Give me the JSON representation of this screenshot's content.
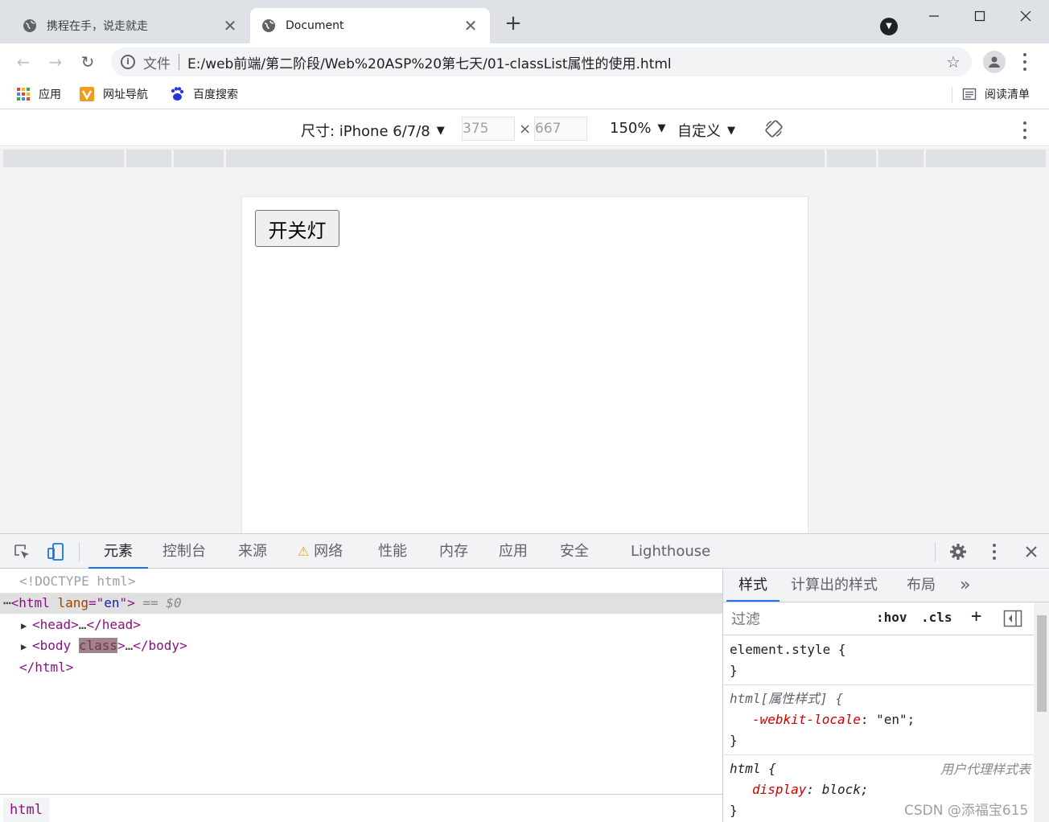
{
  "browser": {
    "tabs": [
      {
        "title": "携程在手，说走就走",
        "active": false,
        "close": "✕"
      },
      {
        "title": "Document",
        "active": true,
        "close": "✕"
      }
    ],
    "new_tab": "+",
    "window_controls": {
      "minimize": "—",
      "maximize": "☐",
      "close": "✕"
    }
  },
  "toolbar": {
    "back": "←",
    "forward": "→",
    "reload": "↻",
    "info_icon": "i",
    "scheme_label": "文件",
    "url": "E:/web前端/第二阶段/Web%20ASP%20第七天/01-classList属性的使用.html",
    "star": "☆"
  },
  "bookmarks": {
    "items": [
      {
        "label": "应用",
        "icon": "apps-grid-icon"
      },
      {
        "label": "网址导航",
        "icon": "nav-icon"
      },
      {
        "label": "百度搜索",
        "icon": "baidu-paw-icon"
      }
    ],
    "reading_list": "阅读清单"
  },
  "device_toolbar": {
    "device": "尺寸: iPhone 6/7/8",
    "width": "375",
    "height": "667",
    "times": "×",
    "zoom": "150%",
    "throttle": "自定义",
    "caret": "▼"
  },
  "page": {
    "button_label": "开关灯"
  },
  "devtools": {
    "tabs": [
      "元素",
      "控制台",
      "来源",
      "网络",
      "性能",
      "内存",
      "应用",
      "安全",
      "Lighthouse"
    ],
    "active_tab": "元素",
    "network_warning": "⚠",
    "dom": {
      "doctype": "<!DOCTYPE html>",
      "html_open_lt": "<html",
      "html_attr": "lang",
      "html_eq": "=\"",
      "html_val": "en",
      "html_close_q": "\">",
      "selected_marker": "== $0",
      "head_open": "<head>",
      "head_ellipsis": "…",
      "head_close": "</head>",
      "body_open_lt": "<body",
      "body_attr": "class",
      "body_gt": ">",
      "body_ellipsis": "…",
      "body_close": "</body>",
      "html_end": "</html>",
      "dots": "⋯",
      "tri": "▶"
    },
    "breadcrumb": "html",
    "styles": {
      "tabs": [
        "样式",
        "计算出的样式",
        "布局"
      ],
      "more": "»",
      "filter_placeholder": "过滤",
      "hov": ":hov",
      "cls": ".cls",
      "plus": "+",
      "rules": [
        {
          "selector": "element.style {",
          "props": [],
          "close": "}",
          "origin": ""
        },
        {
          "selector": "html[属性样式] {",
          "props": [
            {
              "name": "-webkit-locale",
              "value": "\"en\";"
            }
          ],
          "close": "}",
          "origin": ""
        },
        {
          "selector": "html {",
          "props": [
            {
              "name": "display",
              "value": "block;"
            }
          ],
          "close": "}",
          "origin": "用户代理样式表"
        }
      ]
    }
  },
  "watermark": "CSDN @添福宝615"
}
